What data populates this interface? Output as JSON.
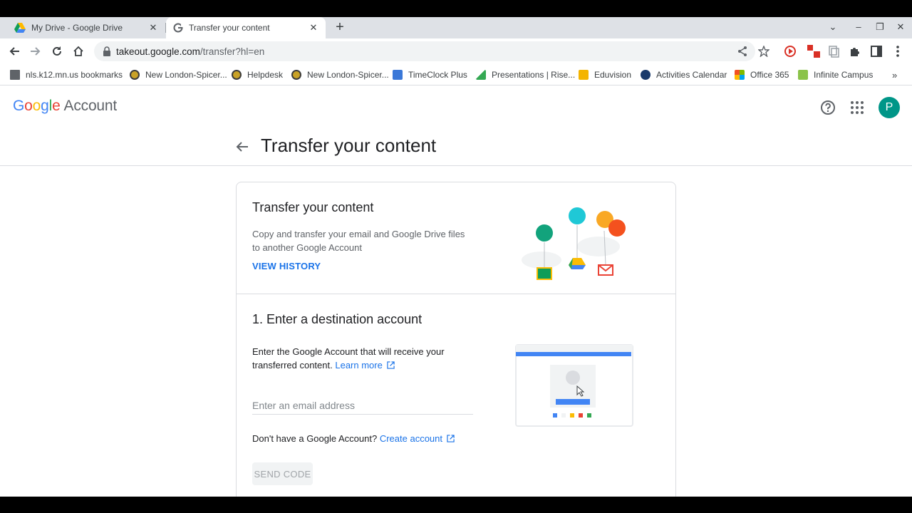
{
  "browser": {
    "tabs": [
      {
        "title": "My Drive - Google Drive",
        "active": false
      },
      {
        "title": "Transfer your content",
        "active": true
      }
    ],
    "url_host": "takeout.google.com",
    "url_path": "/transfer?hl=en",
    "bookmarks": [
      {
        "label": "nls.k12.mn.us bookmarks",
        "icon": "folder-icon",
        "color": "#5f6368"
      },
      {
        "label": "New London-Spicer...",
        "icon": "school-logo-icon",
        "color": "#c9a227"
      },
      {
        "label": "Helpdesk",
        "icon": "school-logo-icon",
        "color": "#c9a227"
      },
      {
        "label": "New London-Spicer...",
        "icon": "school-logo-icon",
        "color": "#c9a227"
      },
      {
        "label": "TimeClock Plus",
        "icon": "timeclock-icon",
        "color": "#3b78d8"
      },
      {
        "label": "Presentations | Rise...",
        "icon": "chart-icon",
        "color": "#34a853"
      },
      {
        "label": "Eduvision",
        "icon": "eduvision-icon",
        "color": "#f4b400"
      },
      {
        "label": "Activities Calendar",
        "icon": "calendar-logo-icon",
        "color": "#1a3a6b"
      },
      {
        "label": "Office 365",
        "icon": "office-icon",
        "color": "#f25022"
      },
      {
        "label": "Infinite Campus",
        "icon": "campus-icon",
        "color": "#8bc34a"
      }
    ]
  },
  "header": {
    "logo_google": "Google",
    "logo_account": "Account",
    "avatar_letter": "P"
  },
  "page": {
    "title": "Transfer your content"
  },
  "card": {
    "title": "Transfer your content",
    "description": "Copy and transfer your email and Google Drive files to another Google Account",
    "view_history": "VIEW HISTORY",
    "step_title": "1. Enter a destination account",
    "step_desc": "Enter the Google Account that will receive your transferred content.",
    "learn_more": "Learn more",
    "email_placeholder": "Enter an email address",
    "no_account_text": "Don't have a Google Account?",
    "create_account": "Create account",
    "send_code": "SEND CODE"
  },
  "colors": {
    "accent": "#1a73e8",
    "avatar": "#009688"
  }
}
